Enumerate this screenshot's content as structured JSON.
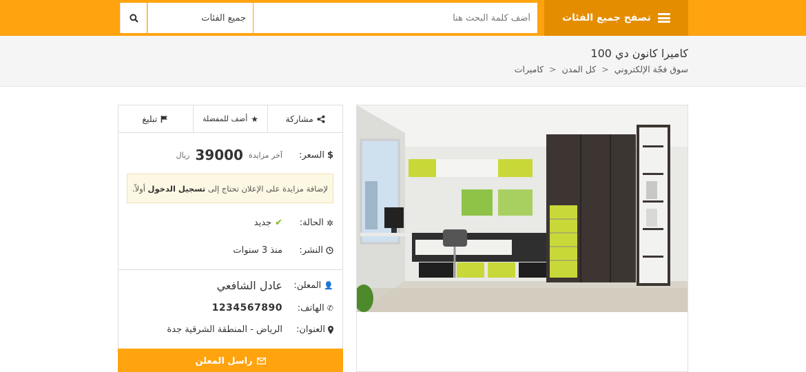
{
  "header": {
    "browse_label": "تصفح جميع الفئات",
    "search_placeholder": "أضف كلمة البحث هنا",
    "category_selected": "جميع الفئات"
  },
  "listing": {
    "title": "كاميرا كانون دي 100",
    "breadcrumb": [
      "سوق فجّة الإلكتروني",
      "كل المدن",
      "كاميرات"
    ]
  },
  "actions": {
    "share": "مشاركة",
    "favorite": "أضف للمفضلة",
    "report": "تبليغ"
  },
  "details": {
    "price_label": "السعر:",
    "last_bid_label": "آخر مزايدة",
    "price_value": "39000",
    "currency": "ريال",
    "notice_before": "لإضافة مزايدة على الإعلان تحتاج إلى",
    "notice_bold": "تسجيل الدخول",
    "notice_after": "أولاً.",
    "status_label": "الحالة:",
    "status_value": "جديد",
    "date_label": "النشر:",
    "date_value": "منذ 3 سنوات",
    "advertiser_label": "المعلن:",
    "advertiser_name": "عادل الشافعي",
    "phone_label": "الهاتف:",
    "phone_value": "1234567890",
    "address_label": "العنوان:",
    "address_value": "الرياض - المنطقة الشرقية جدة",
    "contact_button": "راسل المعلن"
  },
  "colors": {
    "accent": "#ffa30f",
    "accent_dark": "#e58d00",
    "check": "#7cb518"
  },
  "icons": [
    "hamburger-icon",
    "search-icon",
    "share-icon",
    "star-icon",
    "flag-icon",
    "dollar-icon",
    "gear-icon",
    "check-icon",
    "clock-icon",
    "user-icon",
    "phone-icon",
    "map-marker-icon",
    "envelope-icon"
  ]
}
